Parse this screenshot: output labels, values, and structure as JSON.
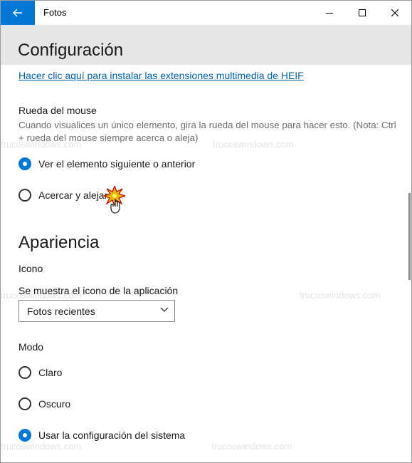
{
  "titlebar": {
    "title": "Fotos",
    "back_icon": "arrow-left-icon",
    "minimize_icon": "minimize-icon",
    "maximize_icon": "maximize-icon",
    "close_icon": "close-icon",
    "accent_color": "#0078d7"
  },
  "header": {
    "title": "Configuración"
  },
  "heif_link": "Hacer clic aquí para instalar las extensiones multimedia de HEIF",
  "mouse_wheel": {
    "label": "Rueda del mouse",
    "description": "Cuando visualices un único elemento, gira la rueda del mouse para hacer esto. (Nota: Ctrl + rueda del mouse siempre acerca o aleja)",
    "options": [
      {
        "label": "Ver el elemento siguiente o anterior",
        "checked": true
      },
      {
        "label": "Acercar y alejar",
        "checked": false
      }
    ]
  },
  "appearance": {
    "heading": "Apariencia",
    "icon_section": {
      "label": "Icono",
      "sublabel": "Se muestra el icono de la aplicación",
      "dropdown_value": "Fotos recientes"
    },
    "mode": {
      "label": "Modo",
      "options": [
        {
          "label": "Claro",
          "checked": false
        },
        {
          "label": "Oscuro",
          "checked": false
        },
        {
          "label": "Usar la configuración del sistema",
          "checked": true
        }
      ]
    }
  },
  "watermark": "trucoswindows.com"
}
